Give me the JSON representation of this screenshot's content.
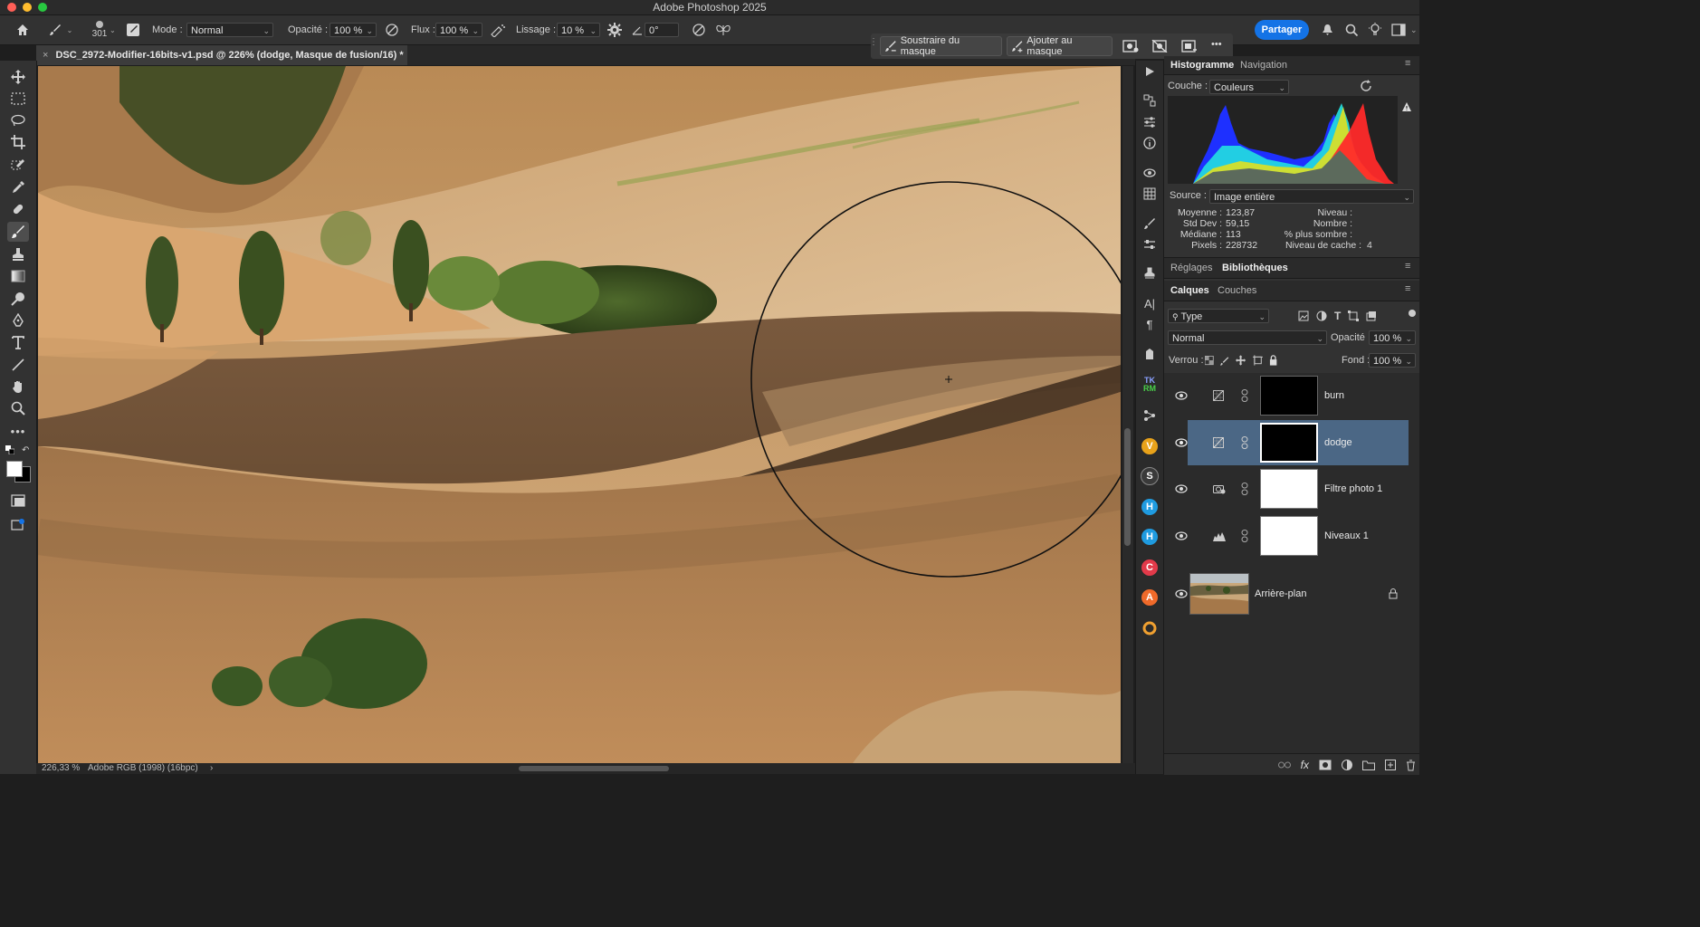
{
  "app": {
    "title": "Adobe Photoshop 2025"
  },
  "options": {
    "brush_size": "301",
    "mode_label": "Mode :",
    "mode_value": "Normal",
    "opacity_label": "Opacité :",
    "opacity_value": "100 %",
    "flow_label": "Flux :",
    "flow_value": "100 %",
    "smoothing_label": "Lissage :",
    "smoothing_value": "10 %",
    "angle_value": "0°",
    "share_label": "Partager"
  },
  "mask_bar": {
    "subtract_label": "Soustraire du masque",
    "add_label": "Ajouter au masque",
    "more": "•••"
  },
  "document": {
    "tab_title": "DSC_2972-Modifier-16bits-v1.psd @ 226% (dodge, Masque de fusion/16) *",
    "close": "×"
  },
  "status": {
    "zoom": "226,33 %",
    "profile": "Adobe RGB (1998) (16bpc)",
    "arrow": "›"
  },
  "histogram": {
    "tabs": [
      "Histogramme",
      "Navigation"
    ],
    "channel_label": "Couche :",
    "channel_value": "Couleurs",
    "source_label": "Source :",
    "source_value": "Image entière",
    "stats_left": [
      {
        "label": "Moyenne :",
        "value": "123,87"
      },
      {
        "label": "Std Dev :",
        "value": "59,15"
      },
      {
        "label": "Médiane :",
        "value": "113"
      },
      {
        "label": "Pixels :",
        "value": "228732"
      }
    ],
    "stats_right": [
      {
        "label": "Niveau :",
        "value": ""
      },
      {
        "label": "Nombre :",
        "value": ""
      },
      {
        "label": "% plus sombre :",
        "value": ""
      },
      {
        "label": "Niveau de cache :",
        "value": "4"
      }
    ]
  },
  "mid_tabs": [
    "Réglages",
    "Bibliothèques"
  ],
  "layers_panel": {
    "tabs": [
      "Calques",
      "Couches"
    ],
    "filter_value": "Type",
    "blend_value": "Normal",
    "opacity_label": "Opacité :",
    "opacity_value": "100 %",
    "lock_label": "Verrou :",
    "fill_label": "Fond :",
    "fill_value": "100 %",
    "layers": [
      {
        "name": "burn",
        "selected": false
      },
      {
        "name": "dodge",
        "selected": true
      },
      {
        "name": "Filtre photo 1",
        "selected": false
      },
      {
        "name": "Niveaux 1",
        "selected": false
      },
      {
        "name": "Arrière-plan",
        "selected": false
      }
    ],
    "footer_fx": "fx"
  },
  "plugin_icons": [
    {
      "letter": "V",
      "color": "#e8a21a"
    },
    {
      "letter": "S",
      "color": "#3a3a3a"
    },
    {
      "letter": "H",
      "color": "#1f9be0"
    },
    {
      "letter": "H",
      "color": "#1f9be0"
    },
    {
      "letter": "C",
      "color": "#e23a4a"
    },
    {
      "letter": "A",
      "color": "#f06a2a"
    }
  ],
  "plugin_tk": {
    "top": "TK",
    "bottom": "RM"
  },
  "colors": {
    "accent": "#1473e6",
    "selected_layer": "#4b6785"
  }
}
